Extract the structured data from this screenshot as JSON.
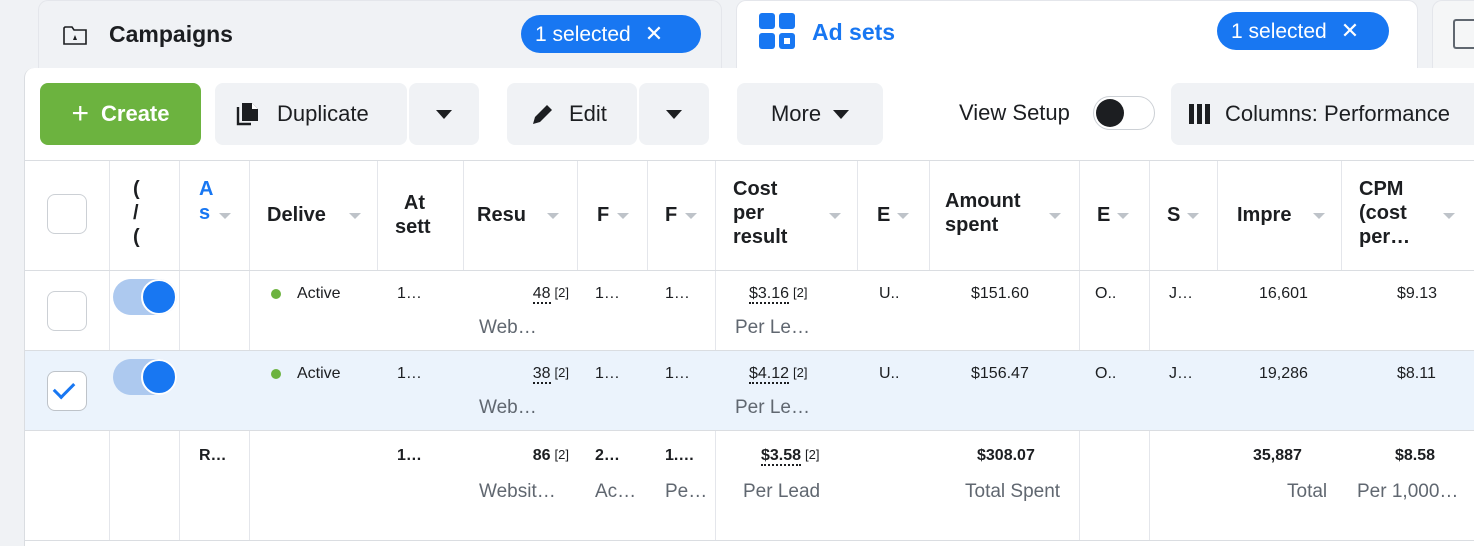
{
  "tabs": {
    "campaigns": {
      "label": "Campaigns",
      "selected": "1 selected",
      "icon": "folder-icon"
    },
    "adsets": {
      "label": "Ad sets",
      "selected": "1 selected",
      "icon": "grid-icon"
    },
    "ads": {
      "icon": "ad-icon"
    }
  },
  "toolbar": {
    "create": "Create",
    "duplicate": "Duplicate",
    "edit": "Edit",
    "more": "More",
    "view_setup": "View Setup",
    "columns": "Columns: Performance"
  },
  "headers": {
    "off_on": "(\n/\n(",
    "name": "A\ns",
    "delivery": "Delive",
    "attribution": "At\nsett",
    "results": "Resu",
    "reach": "F",
    "frequency": "F",
    "cost_per_result": "Cost\nper\nresult",
    "budget": "E",
    "amount_spent": "Amount\nspent",
    "ends": "E",
    "schedule": "S",
    "impressions": "Impre",
    "cpm": "CPM\n(cost\nper…"
  },
  "rows": [
    {
      "delivery": "Active",
      "attribution": "1…",
      "results": "48",
      "results_sup": "[2]",
      "results_sub": "Web…",
      "reach": "1…",
      "frequency": "1…",
      "cost_per_result": "$3.16",
      "cost_sup": "[2]",
      "cost_sub": "Per Le…",
      "budget": "U..",
      "amount_spent": "$151.60",
      "ends": "O..",
      "schedule": "J…",
      "impressions": "16,601",
      "cpm": "$9.13",
      "checked": false
    },
    {
      "delivery": "Active",
      "attribution": "1…",
      "results": "38",
      "results_sup": "[2]",
      "results_sub": "Web…",
      "reach": "1…",
      "frequency": "1…",
      "cost_per_result": "$4.12",
      "cost_sup": "[2]",
      "cost_sub": "Per Le…",
      "budget": "U..",
      "amount_spent": "$156.47",
      "ends": "O..",
      "schedule": "J…",
      "impressions": "19,286",
      "cpm": "$8.11",
      "checked": true
    }
  ],
  "totals": {
    "name": "R…",
    "attribution": "1…",
    "results": "86",
    "results_sup": "[2]",
    "results_sub": "Websit…",
    "reach": "2…",
    "reach_sub": "Ac…",
    "frequency": "1.…",
    "frequency_sub": "Pe…",
    "cost_per_result": "$3.58",
    "cost_sup": "[2]",
    "cost_sub": "Per Lead",
    "amount_spent": "$308.07",
    "amount_sub": "Total Spent",
    "impressions": "35,887",
    "impressions_sub": "Total",
    "cpm": "$8.58",
    "cpm_sub": "Per 1,000…"
  },
  "colors": {
    "accent": "#1877f2",
    "create": "#6cb33f",
    "selected_row": "#ebf3fc"
  }
}
